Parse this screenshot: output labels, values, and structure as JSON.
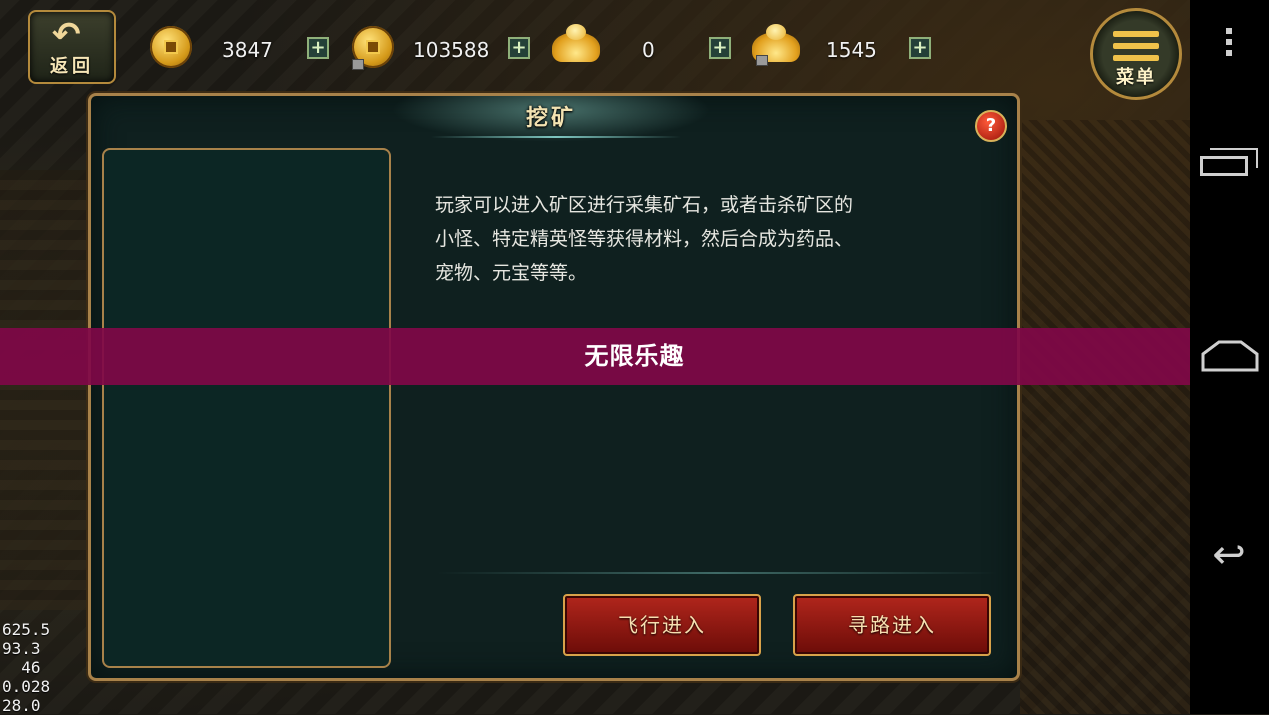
{
  "top_bar": {
    "back_label": "返回",
    "resources": [
      {
        "icon": "copper-coin-icon",
        "value": "3847"
      },
      {
        "icon": "bound-copper-coin-icon",
        "value": "103588"
      },
      {
        "icon": "gold-ingot-icon",
        "value": "0"
      },
      {
        "icon": "bound-gold-ingot-icon",
        "value": "1545"
      }
    ],
    "plus_label": "+",
    "menu_label": "菜单"
  },
  "dialog": {
    "title": "挖矿",
    "help_label": "?",
    "description_lines": [
      "玩家可以进入矿区进行采集矿石，或者击杀矿区的",
      "小怪、特定精英怪等获得材料，然后合成为药品、",
      "宠物、元宝等等。"
    ],
    "fly_button": "飞行进入",
    "path_button": "寻路进入"
  },
  "banner": {
    "text": "无限乐趣"
  },
  "stats": [
    "625.5",
    "93.3",
    "  46",
    "0.028",
    "28.0"
  ],
  "colors": {
    "banner": "#800848",
    "panel_border": "#a8824a",
    "button_red": "#b1261c",
    "gold": "#f0c24a"
  }
}
